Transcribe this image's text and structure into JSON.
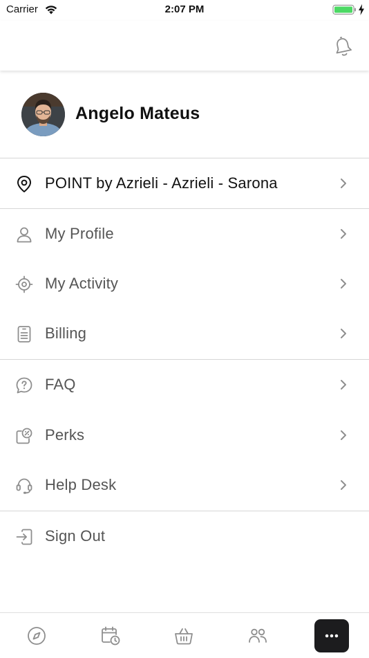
{
  "status_bar": {
    "carrier": "Carrier",
    "time": "2:07 PM",
    "battery_color": "#4cd964"
  },
  "header": {
    "bell_icon": "bell-icon"
  },
  "profile": {
    "name": "Angelo Mateus",
    "avatar": "user-avatar"
  },
  "location": {
    "label": "POINT by Azrieli - Azrieli - Sarona",
    "icon": "location-pin-icon"
  },
  "menu": {
    "group1": [
      {
        "label": "My Profile",
        "icon": "user-icon"
      },
      {
        "label": "My Activity",
        "icon": "crosshair-icon"
      },
      {
        "label": "Billing",
        "icon": "receipt-icon"
      }
    ],
    "group2": [
      {
        "label": "FAQ",
        "icon": "question-bubble-icon"
      },
      {
        "label": "Perks",
        "icon": "percent-tag-icon"
      },
      {
        "label": "Help Desk",
        "icon": "headset-icon"
      }
    ],
    "sign_out": {
      "label": "Sign Out",
      "icon": "sign-out-icon"
    }
  },
  "tab_bar": {
    "tabs": [
      "compass-icon",
      "calendar-clock-icon",
      "basket-icon",
      "people-icon",
      "more-icon"
    ],
    "active_tab": "more-icon",
    "active_bg": "#1c1c1e"
  },
  "colors": {
    "text_primary": "#111111",
    "text_secondary": "#555555",
    "icon_gray": "#8e8e8e",
    "divider": "#d6d6d6"
  }
}
